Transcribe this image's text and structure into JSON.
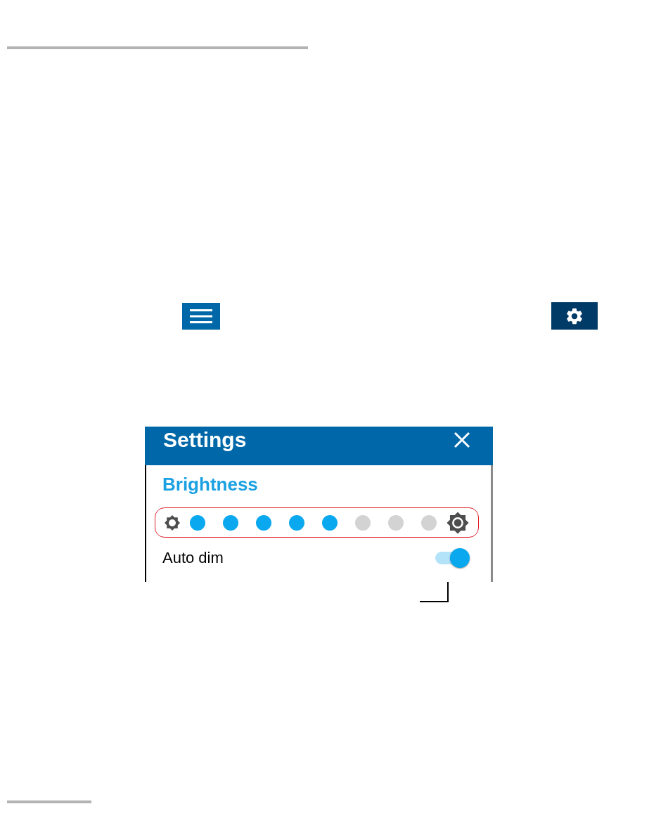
{
  "settings_panel": {
    "title": "Settings",
    "section": "Brightness",
    "brightness_steps": [
      {
        "on": true
      },
      {
        "on": true
      },
      {
        "on": true
      },
      {
        "on": true
      },
      {
        "on": true
      },
      {
        "on": false
      },
      {
        "on": false
      },
      {
        "on": false
      }
    ],
    "auto_dim": {
      "label": "Auto dim",
      "on": true
    }
  }
}
